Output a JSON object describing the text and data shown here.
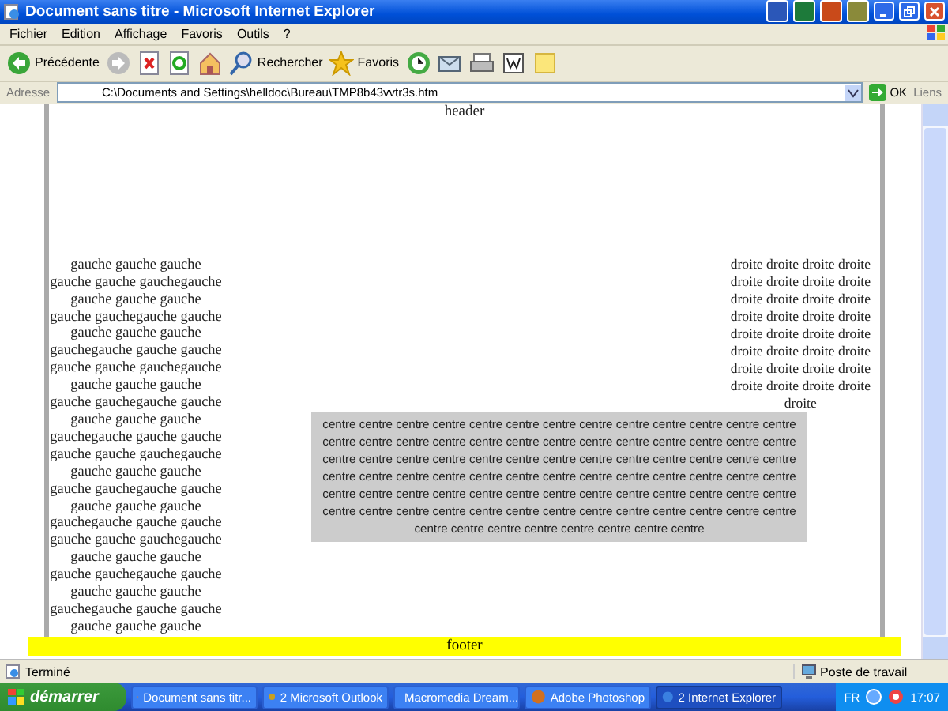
{
  "window": {
    "title": "Document sans titre - Microsoft Internet Explorer"
  },
  "menu": [
    "Fichier",
    "Edition",
    "Affichage",
    "Favoris",
    "Outils",
    "?"
  ],
  "toolbar": [
    {
      "kind": "back",
      "label": "Précédente"
    },
    {
      "kind": "forward"
    },
    {
      "kind": "stop"
    },
    {
      "kind": "refresh"
    },
    {
      "kind": "home"
    },
    {
      "kind": "search",
      "label": "Rechercher"
    },
    {
      "kind": "favorites",
      "label": "Favoris"
    },
    {
      "kind": "history"
    },
    {
      "kind": "mail"
    },
    {
      "kind": "print"
    },
    {
      "kind": "edit"
    },
    {
      "kind": "note"
    }
  ],
  "address": {
    "label": "Adresse",
    "value": "C:\\Documents and Settings\\helldoc\\Bureau\\TMP8b43vvtr3s.htm",
    "go": "OK",
    "links": "Liens"
  },
  "page": {
    "header": "header",
    "left_lines": [
      "gauche gauche gauche",
      "gauche gauche gauchegauche",
      "gauche gauche gauche",
      "gauche gauchegauche gauche",
      "gauche gauche gauche",
      "gauchegauche gauche gauche",
      "gauche gauche gauchegauche",
      "gauche gauche gauche",
      "gauche gauchegauche gauche",
      "gauche gauche gauche",
      "gauchegauche gauche gauche",
      "gauche gauche gauchegauche",
      "gauche gauche gauche",
      "gauche gauchegauche gauche",
      "gauche gauche gauche",
      "gauchegauche gauche gauche",
      "gauche gauche gauchegauche",
      "gauche gauche gauche",
      "gauche gauchegauche gauche",
      "gauche gauche gauche",
      "gauchegauche gauche gauche",
      "gauche gauche gauche"
    ],
    "right_lines": [
      "droite droite droite droite",
      "droite droite droite droite",
      "droite droite droite droite",
      "droite droite droite droite",
      "droite droite droite droite",
      "droite droite droite droite",
      "droite droite droite droite",
      "droite droite droite droite",
      "droite"
    ],
    "centre_lines": [
      "centre centre centre centre centre centre centre centre centre centre centre centre centre",
      "centre centre centre centre centre centre centre centre centre centre centre centre centre",
      "centre centre centre centre centre centre centre centre centre centre centre centre centre",
      "centre centre centre centre centre centre centre centre centre centre centre centre centre",
      "centre centre centre centre centre centre centre centre centre centre centre centre centre",
      "centre centre centre centre centre centre centre centre centre centre centre centre centre",
      "centre centre centre centre centre centre centre centre"
    ],
    "footer": "footer"
  },
  "status_bar": {
    "text": "Terminé",
    "zone": "Poste de travail"
  },
  "taskbar": {
    "start": "démarrer",
    "tasks": [
      {
        "label": "Document sans titr...",
        "selected": false
      },
      {
        "label": "2 Microsoft Outlook",
        "selected": false
      },
      {
        "label": "Macromedia Dream...",
        "selected": false
      },
      {
        "label": "Adobe Photoshop",
        "selected": false
      },
      {
        "label": "2 Internet Explorer",
        "selected": true
      }
    ],
    "language": "FR",
    "clock": "17:07"
  }
}
